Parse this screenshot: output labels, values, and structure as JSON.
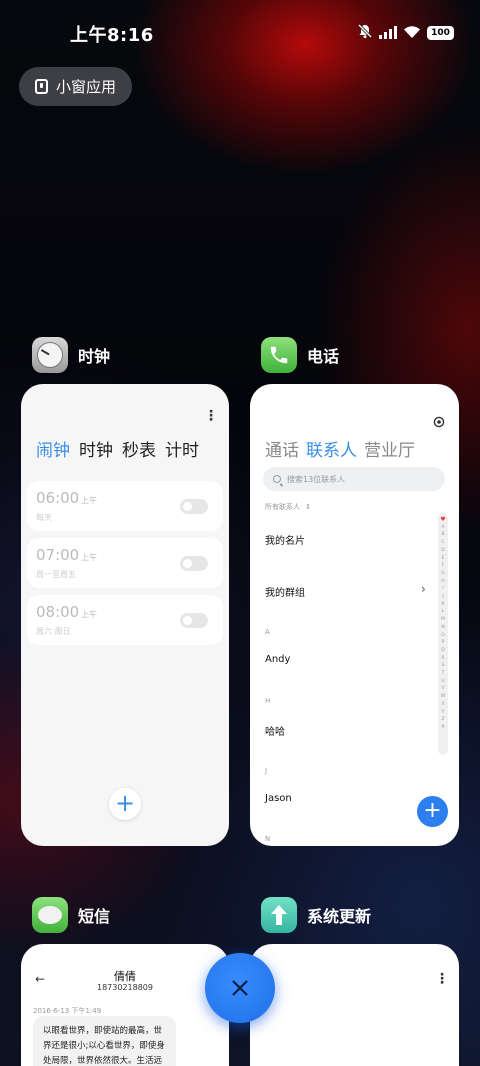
{
  "status_bar": {
    "time": "上午8:16",
    "battery": "100"
  },
  "float_button": {
    "label": "小窗应用"
  },
  "apps": {
    "clock": {
      "name": "时钟",
      "tabs": [
        "闹钟",
        "时钟",
        "秒表",
        "计时"
      ],
      "active_tab": 0,
      "alarms": [
        {
          "time": "06:00",
          "ampm": "上午",
          "repeat": "每天",
          "enabled": false
        },
        {
          "time": "07:00",
          "ampm": "上午",
          "repeat": "周一至周五",
          "enabled": false
        },
        {
          "time": "08:00",
          "ampm": "上午",
          "repeat": "周六 周日",
          "enabled": false
        }
      ],
      "add_label": "+"
    },
    "phone": {
      "name": "电话",
      "tabs": [
        "通话",
        "联系人",
        "营业厅"
      ],
      "active_tab": 1,
      "search_placeholder": "搜索13位联系人",
      "filter_label": "所有联系人",
      "my_card": "我的名片",
      "my_groups": "我的群组",
      "sections": [
        {
          "letter": "A",
          "name": "Andy"
        },
        {
          "letter": "H",
          "name": "哈哈"
        },
        {
          "letter": "J",
          "name": "Jason"
        },
        {
          "letter": "N",
          "name": ""
        }
      ],
      "index_letters": [
        "A",
        "B",
        "C",
        "D",
        "E",
        "F",
        "G",
        "H",
        "I",
        "J",
        "K",
        "L",
        "M",
        "N",
        "O",
        "P",
        "Q",
        "R",
        "S",
        "T",
        "U",
        "V",
        "W",
        "X",
        "Y",
        "Z",
        "#"
      ],
      "fab_label": "+"
    },
    "sms": {
      "name": "短信",
      "contact_name": "倩倩",
      "contact_number": "18730218809",
      "message_time": "2016-6-13 下午1:49",
      "message_text": "以眼看世界，即使站的最高，世界还是很小;以心看世界，即使身处局限，世界依然很大。生活远"
    },
    "update": {
      "name": "系统更新"
    }
  },
  "colors": {
    "accent": "#3a8ee6",
    "fab": "#2d7ff0",
    "close": "#2a7cf5"
  },
  "close_button": {
    "icon": "close-icon"
  }
}
